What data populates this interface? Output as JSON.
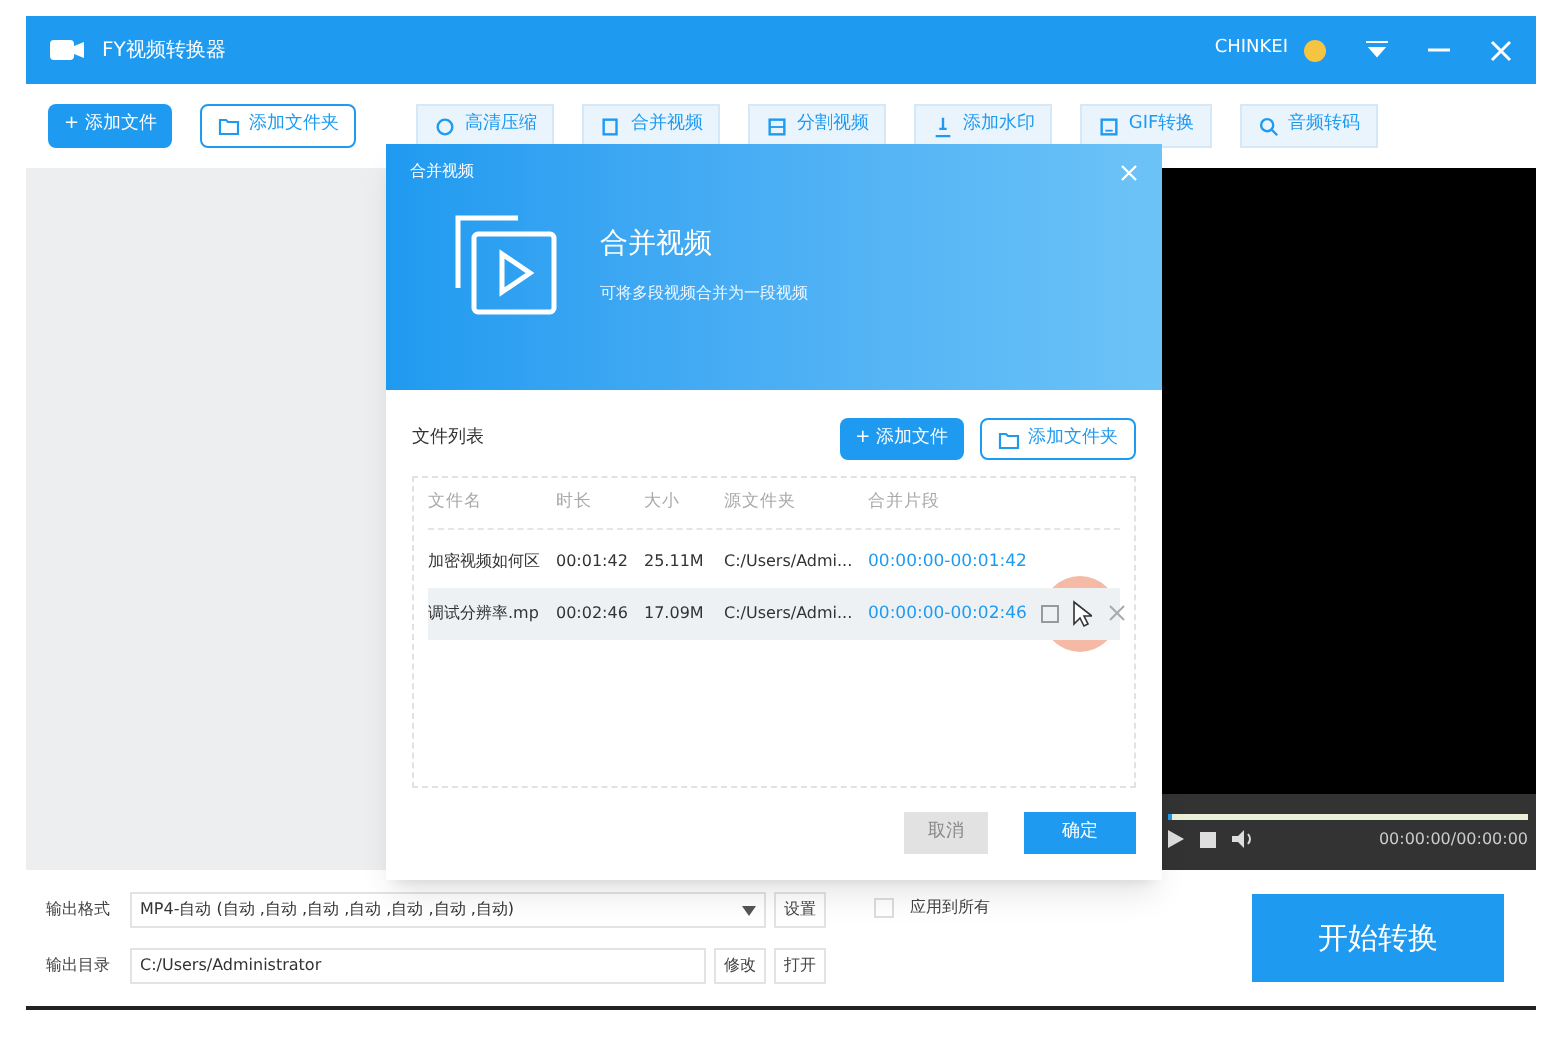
{
  "window": {
    "title": "FY视频转换器",
    "user": "CHINKEI"
  },
  "toolbar": {
    "add_file": "+ 添加文件",
    "add_folder": "添加文件夹",
    "tools": [
      {
        "label": "高清压缩",
        "kind": "compress"
      },
      {
        "label": "合并视频",
        "kind": "merge"
      },
      {
        "label": "分割视频",
        "kind": "split"
      },
      {
        "label": "添加水印",
        "kind": "watermark"
      },
      {
        "label": "GIF转换",
        "kind": "gif"
      },
      {
        "label": "音频转码",
        "kind": "search"
      }
    ]
  },
  "player": {
    "level": 0.01,
    "time": "00:00:00/00:00:00"
  },
  "dialog": {
    "title": "合并视频",
    "heading": "合并视频",
    "subtitle": "可将多段视频合并为一段视频",
    "list_label": "文件列表",
    "add_file": "+ 添加文件",
    "add_folder": "添加文件夹",
    "columns": [
      "文件名",
      "时长",
      "大小",
      "源文件夹",
      "合并片段"
    ],
    "rows": [
      {
        "cells": [
          "加密视频如何区",
          "00:01:42",
          "25.11M",
          "C:/Users/Admi..."
        ],
        "range": "00:00:00-00:01:42",
        "hovered": false
      },
      {
        "cells": [
          "调试分辨率.mp",
          "00:02:46",
          "17.09M",
          "C:/Users/Admi..."
        ],
        "range": "00:00:00-00:02:46",
        "hovered": true
      }
    ],
    "cancel": {
      "label": "取消",
      "disabled": true
    },
    "ok": {
      "label": "确定",
      "disabled": false
    }
  },
  "output": {
    "format_label": "输出格式",
    "format": "MP4-自动 (自动 ,自动 ,自动 ,自动 ,自动 ,自动 ,自动)",
    "settings": "设置",
    "apply_all": {
      "label": "应用到所有",
      "checked": false
    },
    "dir_label": "输出目录",
    "dir": "C:/Users/Administrator",
    "modify": "修改",
    "open": "打开",
    "start": "开始转换"
  }
}
